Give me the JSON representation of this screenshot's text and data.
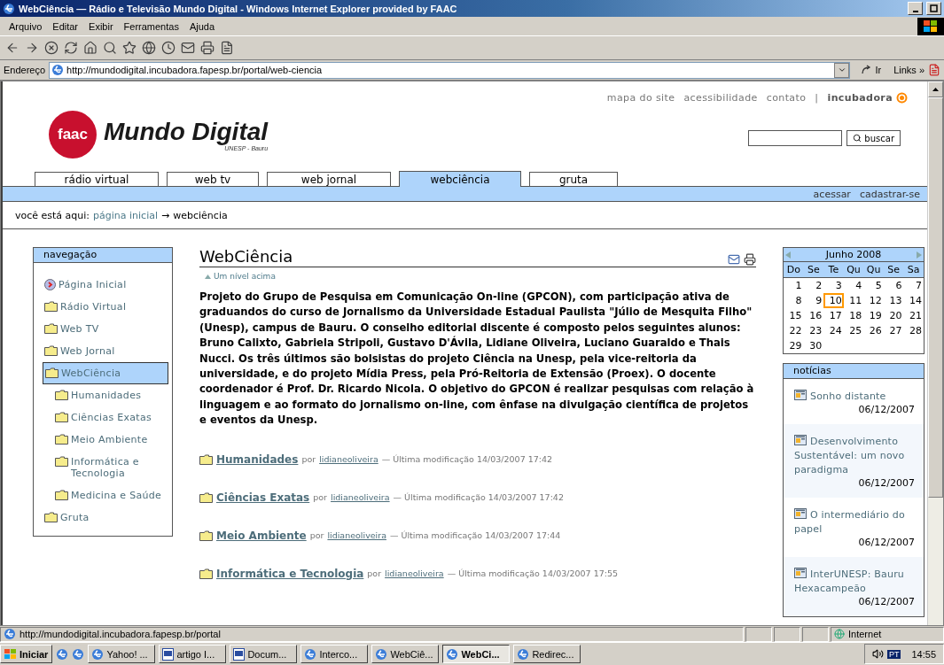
{
  "window": {
    "title": "WebCiência — Rádio e Televisão Mundo Digital - Windows Internet Explorer provided by FAAC"
  },
  "menu": [
    "Arquivo",
    "Editar",
    "Exibir",
    "Ferramentas",
    "Ajuda"
  ],
  "address": {
    "label": "Endereço",
    "value": "http://mundodigital.incubadora.fapesp.br/portal/web-ciencia",
    "go": "Ir",
    "links": "Links",
    "more": "»"
  },
  "top_links": [
    {
      "label": "mapa do site",
      "kind": "link"
    },
    {
      "label": "acessibilidade",
      "kind": "link"
    },
    {
      "label": "contato",
      "kind": "link"
    },
    {
      "label": "|",
      "kind": "sep"
    },
    {
      "label": "incubadora",
      "kind": "brand"
    }
  ],
  "logo": {
    "mark": "faac",
    "name": "Mundo Digital",
    "sub": "UNESP - Bauru"
  },
  "search": {
    "button": "buscar"
  },
  "tabs": [
    {
      "label": "rádio virtual",
      "selected": false
    },
    {
      "label": "web tv",
      "selected": false
    },
    {
      "label": "web jornal",
      "selected": false
    },
    {
      "label": "webciência",
      "selected": true
    },
    {
      "label": "gruta",
      "selected": false
    }
  ],
  "user_links": [
    "acessar",
    "cadastrar-se"
  ],
  "breadcrumb": {
    "label": "você está aqui:",
    "link": "página inicial",
    "arrow": "→",
    "current": "webciência"
  },
  "navigation": {
    "title": "navegação",
    "items": [
      {
        "label": "Página Inicial",
        "kind": "home",
        "selected": false
      },
      {
        "label": "Rádio Virtual",
        "kind": "folder",
        "selected": false
      },
      {
        "label": "Web TV",
        "kind": "folder",
        "selected": false
      },
      {
        "label": "Web Jornal",
        "kind": "folder",
        "selected": false
      },
      {
        "label": "WebCiência",
        "kind": "folder",
        "selected": true,
        "children": [
          {
            "label": "Humanidades",
            "kind": "folder",
            "selected": false
          },
          {
            "label": "Ciências Exatas",
            "kind": "folder",
            "selected": false
          },
          {
            "label": "Meio Ambiente",
            "kind": "folder",
            "selected": false
          },
          {
            "label": "Informática e Tecnologia",
            "kind": "folder",
            "selected": false
          },
          {
            "label": "Medicina e Saúde",
            "kind": "folder",
            "selected": false
          }
        ]
      },
      {
        "label": "Gruta",
        "kind": "folder",
        "selected": false
      }
    ]
  },
  "content": {
    "title": "WebCiência",
    "up_link": "Um nível acima",
    "description": "Projeto do Grupo de Pesquisa em Comunicação On-line (GPCON), com participação ativa de graduandos do curso de Jornalismo da Universidade Estadual Paulista \"Júlio de Mesquita Filho\" (Unesp), campus de Bauru. O conselho editorial discente é composto pelos seguintes alunos: Bruno Calixto, Gabriela Stripoli, Gustavo D'Ávila, Lidiane Oliveira, Luciano Guaraldo e Thais Nucci. Os três últimos são bolsistas do projeto Ciência na Unesp, pela vice-reitoria da universidade, e do projeto Mídia Press, pela Pró-Reitoria de Extensão (Proex). O docente coordenador é Prof. Dr. Ricardo Nicola. O objetivo do GPCON é realizar pesquisas com relação à linguagem e ao formato do jornalismo on-line, com ênfase na divulgação científica de projetos e eventos da Unesp.",
    "folders": [
      {
        "title": "Humanidades",
        "by": "por",
        "author": "lidianeoliveira",
        "modified": "— Última modificação 14/03/2007 17:42"
      },
      {
        "title": "Ciências Exatas",
        "by": "por",
        "author": "lidianeoliveira",
        "modified": "— Última modificação 14/03/2007 17:42"
      },
      {
        "title": "Meio Ambiente",
        "by": "por",
        "author": "lidianeoliveira",
        "modified": "— Última modificação 14/03/2007 17:44"
      },
      {
        "title": "Informática e Tecnologia",
        "by": "por",
        "author": "lidianeoliveira",
        "modified": "— Última modificação 14/03/2007 17:55"
      }
    ]
  },
  "calendar": {
    "month": "Junho 2008",
    "weekdays": [
      "Do",
      "Se",
      "Te",
      "Qu",
      "Qu",
      "Se",
      "Sa"
    ],
    "weeks": [
      [
        {
          "day": "1",
          "selected": false
        },
        {
          "day": "2",
          "selected": false
        },
        {
          "day": "3",
          "selected": false
        },
        {
          "day": "4",
          "selected": false
        },
        {
          "day": "5",
          "selected": false
        },
        {
          "day": "6",
          "selected": false
        },
        {
          "day": "7",
          "selected": false
        }
      ],
      [
        {
          "day": "8",
          "selected": false
        },
        {
          "day": "9",
          "selected": false
        },
        {
          "day": "10",
          "selected": true
        },
        {
          "day": "11",
          "selected": false
        },
        {
          "day": "12",
          "selected": false
        },
        {
          "day": "13",
          "selected": false
        },
        {
          "day": "14",
          "selected": false
        }
      ],
      [
        {
          "day": "15",
          "selected": false
        },
        {
          "day": "16",
          "selected": false
        },
        {
          "day": "17",
          "selected": false
        },
        {
          "day": "18",
          "selected": false
        },
        {
          "day": "19",
          "selected": false
        },
        {
          "day": "20",
          "selected": false
        },
        {
          "day": "21",
          "selected": false
        }
      ],
      [
        {
          "day": "22",
          "selected": false
        },
        {
          "day": "23",
          "selected": false
        },
        {
          "day": "24",
          "selected": false
        },
        {
          "day": "25",
          "selected": false
        },
        {
          "day": "26",
          "selected": false
        },
        {
          "day": "27",
          "selected": false
        },
        {
          "day": "28",
          "selected": false
        }
      ],
      [
        {
          "day": "29",
          "selected": false
        },
        {
          "day": "30",
          "selected": false
        }
      ]
    ]
  },
  "news": {
    "title": "notícias",
    "items": [
      {
        "title": "Sonho distante",
        "date": "06/12/2007"
      },
      {
        "title": "Desenvolvimento Sustentável: um novo paradigma",
        "date": "06/12/2007"
      },
      {
        "title": "O intermediário do papel",
        "date": "06/12/2007"
      },
      {
        "title": "InterUNESP: Bauru Hexacampeão",
        "date": "06/12/2007"
      }
    ]
  },
  "status_bar": {
    "url": "http://mundodigital.incubadora.fapesp.br/portal",
    "zone": "Internet"
  },
  "taskbar": {
    "start": "Iniciar",
    "tasks": [
      {
        "label": "Yahoo! ...",
        "kind": "ie",
        "selected": false
      },
      {
        "label": "artigo I...",
        "kind": "word",
        "selected": false
      },
      {
        "label": "Docum...",
        "kind": "word",
        "selected": false
      },
      {
        "label": "Interco...",
        "kind": "ie",
        "selected": false
      },
      {
        "label": "WebCiê...",
        "kind": "ie",
        "selected": false
      },
      {
        "label": "WebCi...",
        "kind": "ie",
        "selected": true
      },
      {
        "label": "Redirec...",
        "kind": "ie",
        "selected": false
      }
    ],
    "tray_lang": "PT",
    "time": "14:55"
  }
}
